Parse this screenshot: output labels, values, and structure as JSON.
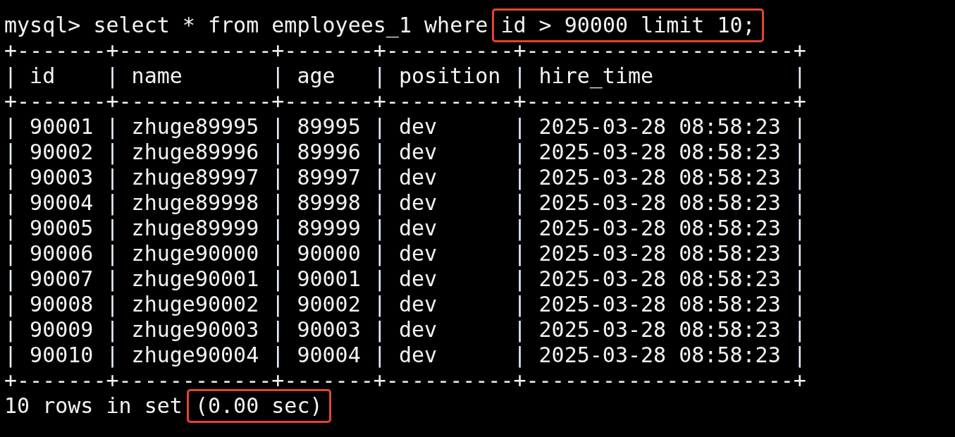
{
  "prompt": {
    "prefix": "mysql> ",
    "query": "select * from employees_1 where ",
    "highlighted": "id > 90000 limit 10;"
  },
  "table": {
    "border": "+-------+------------+-------+----------+---------------------+",
    "separator": "|",
    "columns": [
      "id",
      "name",
      "age",
      "position",
      "hire_time"
    ],
    "rows": [
      [
        "90001",
        "zhuge89995",
        "89995",
        "dev",
        "2025-03-28 08:58:23"
      ],
      [
        "90002",
        "zhuge89996",
        "89996",
        "dev",
        "2025-03-28 08:58:23"
      ],
      [
        "90003",
        "zhuge89997",
        "89997",
        "dev",
        "2025-03-28 08:58:23"
      ],
      [
        "90004",
        "zhuge89998",
        "89998",
        "dev",
        "2025-03-28 08:58:23"
      ],
      [
        "90005",
        "zhuge89999",
        "89999",
        "dev",
        "2025-03-28 08:58:23"
      ],
      [
        "90006",
        "zhuge90000",
        "90000",
        "dev",
        "2025-03-28 08:58:23"
      ],
      [
        "90007",
        "zhuge90001",
        "90001",
        "dev",
        "2025-03-28 08:58:23"
      ],
      [
        "90008",
        "zhuge90002",
        "90002",
        "dev",
        "2025-03-28 08:58:23"
      ],
      [
        "90009",
        "zhuge90003",
        "90003",
        "dev",
        "2025-03-28 08:58:23"
      ],
      [
        "90010",
        "zhuge90004",
        "90004",
        "dev",
        "2025-03-28 08:58:23"
      ]
    ]
  },
  "result": {
    "summary": "10 rows in set ",
    "timing": "(0.00 sec)"
  }
}
